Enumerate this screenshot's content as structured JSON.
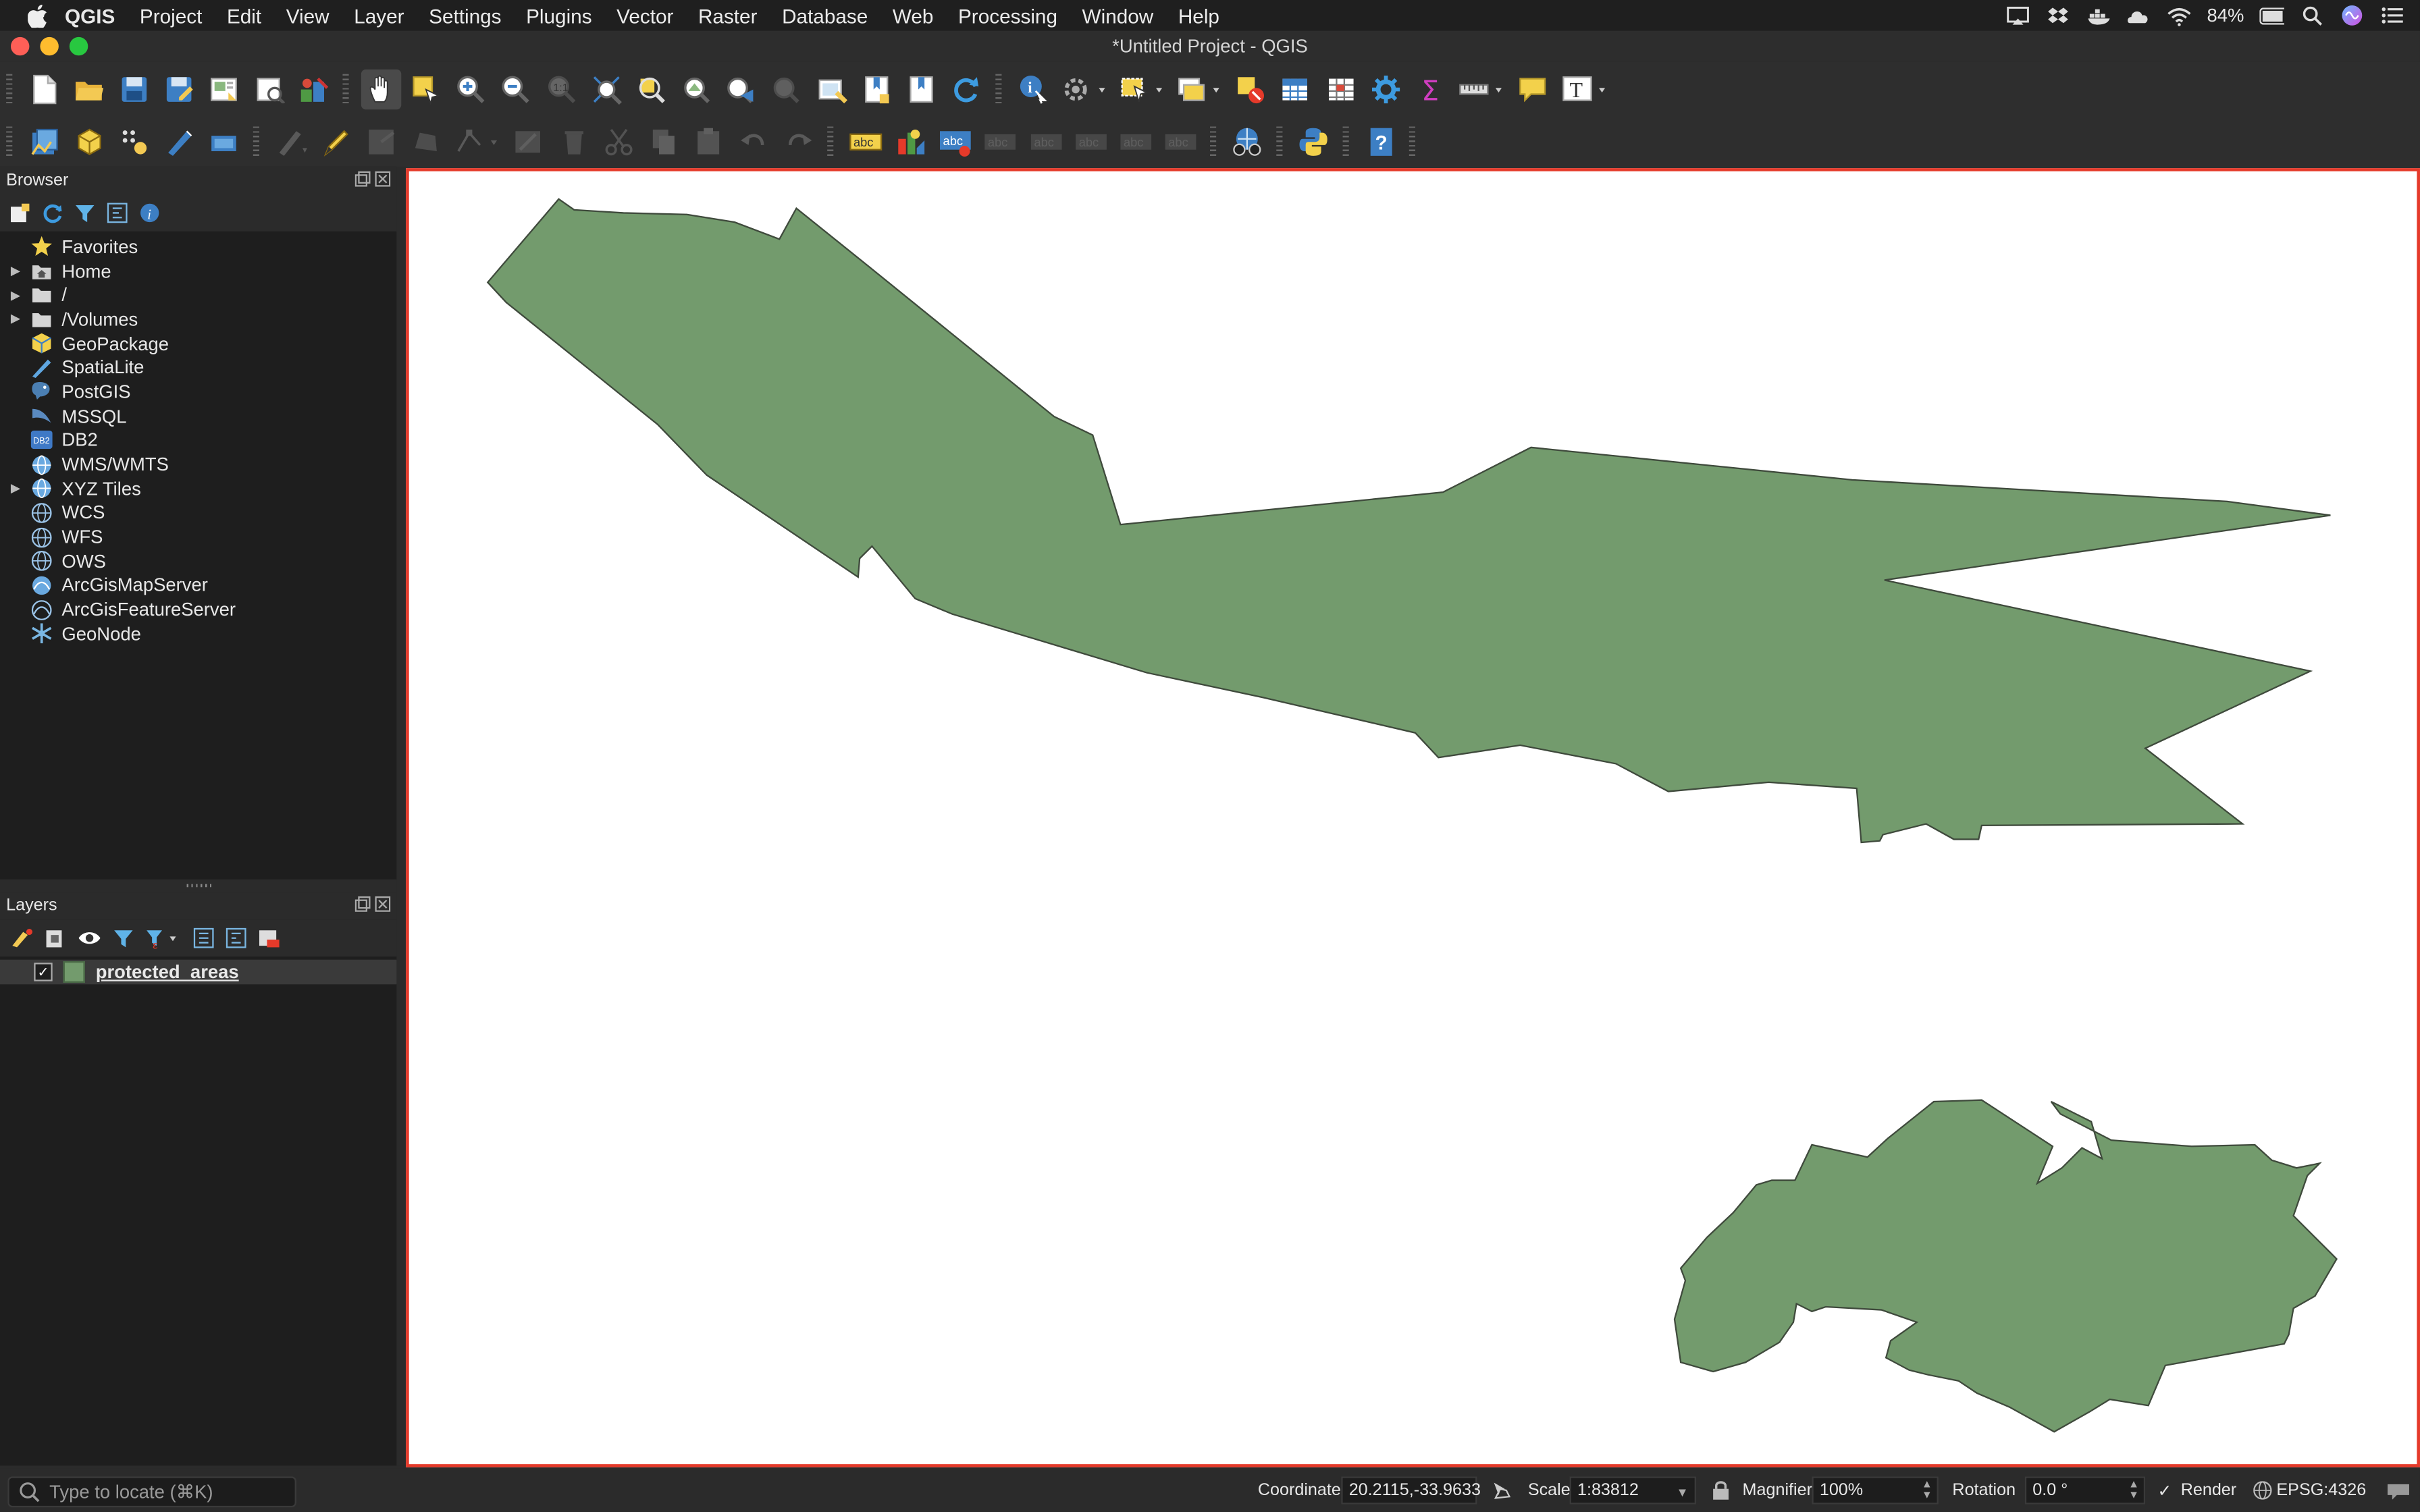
{
  "menubar": {
    "app_name": "QGIS",
    "items": [
      "Project",
      "Edit",
      "View",
      "Layer",
      "Settings",
      "Plugins",
      "Vector",
      "Raster",
      "Database",
      "Web",
      "Processing",
      "Window",
      "Help"
    ],
    "battery": "84%"
  },
  "window": {
    "title": "*Untitled Project - QGIS"
  },
  "browser": {
    "title": "Browser",
    "items": [
      {
        "label": "Favorites",
        "icon": "star-icon"
      },
      {
        "label": "Home",
        "icon": "home-folder-icon"
      },
      {
        "label": "/",
        "icon": "folder-icon"
      },
      {
        "label": "/Volumes",
        "icon": "folder-icon"
      },
      {
        "label": "GeoPackage",
        "icon": "geopackage-icon"
      },
      {
        "label": "SpatiaLite",
        "icon": "spatialite-icon"
      },
      {
        "label": "PostGIS",
        "icon": "postgis-icon"
      },
      {
        "label": "MSSQL",
        "icon": "mssql-icon"
      },
      {
        "label": "DB2",
        "icon": "db2-icon"
      },
      {
        "label": "WMS/WMTS",
        "icon": "globe-icon"
      },
      {
        "label": "XYZ Tiles",
        "icon": "globe-icon"
      },
      {
        "label": "WCS",
        "icon": "globe-icon"
      },
      {
        "label": "WFS",
        "icon": "globe-icon"
      },
      {
        "label": "OWS",
        "icon": "globe-icon"
      },
      {
        "label": "ArcGisMapServer",
        "icon": "arcgis-icon"
      },
      {
        "label": "ArcGisFeatureServer",
        "icon": "arcgis-icon"
      },
      {
        "label": "GeoNode",
        "icon": "geonode-icon"
      }
    ],
    "db2_badge": "DB2"
  },
  "layers": {
    "title": "Layers",
    "items": [
      {
        "name": "protected_areas",
        "checked": true,
        "color": "#739b6d"
      }
    ]
  },
  "map": {
    "polygon_fill": "#739b6d",
    "polygon_stroke": "#3f4a3c",
    "frame_color": "#e53a2a"
  },
  "statusbar": {
    "locate_placeholder": "Type to locate (⌘K)",
    "coordinate_label": "Coordinate",
    "coordinate_value": "20.2115,-33.9633",
    "scale_label": "Scale",
    "scale_value": "1:83812",
    "magnifier_label": "Magnifier",
    "magnifier_value": "100%",
    "rotation_label": "Rotation",
    "rotation_value": "0.0 °",
    "render_label": "Render",
    "crs": "EPSG:4326"
  }
}
